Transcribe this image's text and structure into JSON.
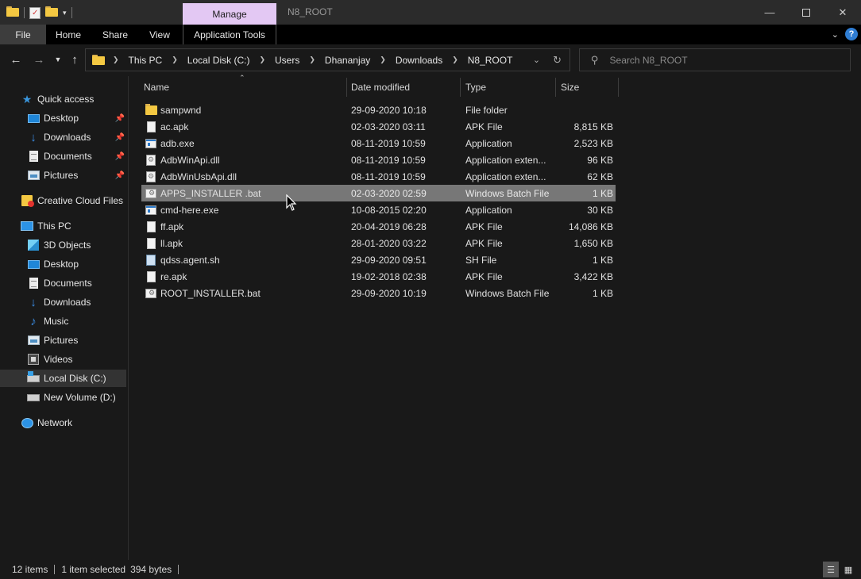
{
  "window": {
    "title": "N8_ROOT",
    "context_tab": "Manage",
    "controls": [
      "minimize",
      "maximize",
      "close"
    ]
  },
  "ribbon": {
    "tabs": [
      "File",
      "Home",
      "Share",
      "View",
      "Application Tools"
    ]
  },
  "address": {
    "breadcrumbs": [
      "This PC",
      "Local Disk (C:)",
      "Users",
      "Dhananjay",
      "Downloads",
      "N8_ROOT"
    ]
  },
  "search": {
    "placeholder": "Search N8_ROOT"
  },
  "sidebar": {
    "items": [
      {
        "label": "Quick access",
        "icon": "star-icon"
      },
      {
        "label": "Desktop",
        "icon": "desktop-icon",
        "pinned": true
      },
      {
        "label": "Downloads",
        "icon": "download-icon",
        "pinned": true
      },
      {
        "label": "Documents",
        "icon": "documents-icon",
        "pinned": true
      },
      {
        "label": "Pictures",
        "icon": "pictures-icon",
        "pinned": true
      },
      {
        "label": "Creative Cloud Files",
        "icon": "creative-cloud-icon"
      },
      {
        "label": "This PC",
        "icon": "computer-icon"
      },
      {
        "label": "3D Objects",
        "icon": "3d-objects-icon"
      },
      {
        "label": "Desktop",
        "icon": "desktop-icon"
      },
      {
        "label": "Documents",
        "icon": "documents-icon"
      },
      {
        "label": "Downloads",
        "icon": "download-icon"
      },
      {
        "label": "Music",
        "icon": "music-icon"
      },
      {
        "label": "Pictures",
        "icon": "pictures-icon"
      },
      {
        "label": "Videos",
        "icon": "videos-icon"
      },
      {
        "label": "Local Disk (C:)",
        "icon": "local-disk-icon",
        "selected": true
      },
      {
        "label": "New Volume (D:)",
        "icon": "drive-icon"
      },
      {
        "label": "Network",
        "icon": "network-icon"
      }
    ]
  },
  "columns": {
    "name": "Name",
    "date": "Date modified",
    "type": "Type",
    "size": "Size"
  },
  "files": [
    {
      "name": "sampwnd",
      "date": "29-09-2020 10:18",
      "type": "File folder",
      "size": "",
      "icon": "folder"
    },
    {
      "name": "ac.apk",
      "date": "02-03-2020 03:11",
      "type": "APK File",
      "size": "8,815 KB",
      "icon": "file"
    },
    {
      "name": "adb.exe",
      "date": "08-11-2019 10:59",
      "type": "Application",
      "size": "2,523 KB",
      "icon": "app"
    },
    {
      "name": "AdbWinApi.dll",
      "date": "08-11-2019 10:59",
      "type": "Application exten...",
      "size": "96 KB",
      "icon": "dll"
    },
    {
      "name": "AdbWinUsbApi.dll",
      "date": "08-11-2019 10:59",
      "type": "Application exten...",
      "size": "62 KB",
      "icon": "dll"
    },
    {
      "name": "APPS_INSTALLER .bat",
      "date": "02-03-2020 02:59",
      "type": "Windows Batch File",
      "size": "1 KB",
      "icon": "bat",
      "selected": true
    },
    {
      "name": "cmd-here.exe",
      "date": "10-08-2015 02:20",
      "type": "Application",
      "size": "30 KB",
      "icon": "app"
    },
    {
      "name": "ff.apk",
      "date": "20-04-2019 06:28",
      "type": "APK File",
      "size": "14,086 KB",
      "icon": "file"
    },
    {
      "name": "ll.apk",
      "date": "28-01-2020 03:22",
      "type": "APK File",
      "size": "1,650 KB",
      "icon": "file"
    },
    {
      "name": "qdss.agent.sh",
      "date": "29-09-2020 09:51",
      "type": "SH File",
      "size": "1 KB",
      "icon": "sh"
    },
    {
      "name": "re.apk",
      "date": "19-02-2018 02:38",
      "type": "APK File",
      "size": "3,422 KB",
      "icon": "file"
    },
    {
      "name": "ROOT_INSTALLER.bat",
      "date": "29-09-2020 10:19",
      "type": "Windows Batch File",
      "size": "1 KB",
      "icon": "bat"
    }
  ],
  "status": {
    "item_count": "12 items",
    "selection": "1 item selected",
    "selection_size": "394 bytes"
  }
}
